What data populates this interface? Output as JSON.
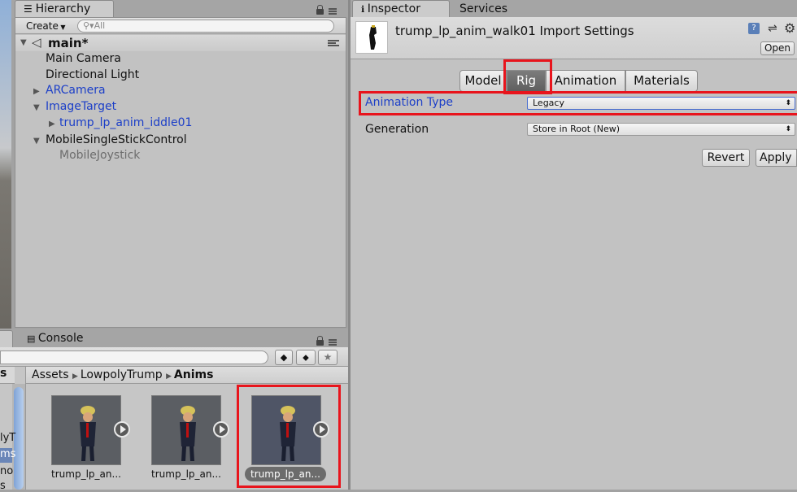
{
  "hierarchy": {
    "tab_label": "Hierarchy",
    "create_label": "Create",
    "search_placeholder": "All",
    "scene_name": "main*",
    "items": [
      {
        "label": "Main Camera"
      },
      {
        "label": "Directional Light"
      },
      {
        "label": "ARCamera"
      },
      {
        "label": "ImageTarget"
      },
      {
        "label": "trump_lp_anim_iddle01"
      },
      {
        "label": "MobileSingleStickControl"
      },
      {
        "label": "MobileJoystick"
      }
    ]
  },
  "console": {
    "tab_label": "Console"
  },
  "project": {
    "breadcrumb": [
      "Assets",
      "LowpolyTrump",
      "Anims"
    ],
    "left_fragments": [
      "s",
      "lyT",
      "ms",
      "no",
      "s"
    ],
    "assets": [
      {
        "label": "trump_lp_an..."
      },
      {
        "label": "trump_lp_an..."
      },
      {
        "label": "trump_lp_an..."
      }
    ]
  },
  "inspector": {
    "tab_label": "Inspector",
    "services_tab_label": "Services",
    "title": "trump_lp_anim_walk01 Import Settings",
    "open_label": "Open",
    "tabs": [
      "Model",
      "Rig",
      "Animation",
      "Materials"
    ],
    "selected_tab": "Rig",
    "animation_type_label": "Animation Type",
    "animation_type_value": "Legacy",
    "generation_label": "Generation",
    "generation_value": "Store in Root (New)",
    "revert_label": "Revert",
    "apply_label": "Apply"
  },
  "colors": {
    "highlight": "#e8141c",
    "selected_tab": "#6f6f6f",
    "link_blue": "#1c3fc8"
  }
}
